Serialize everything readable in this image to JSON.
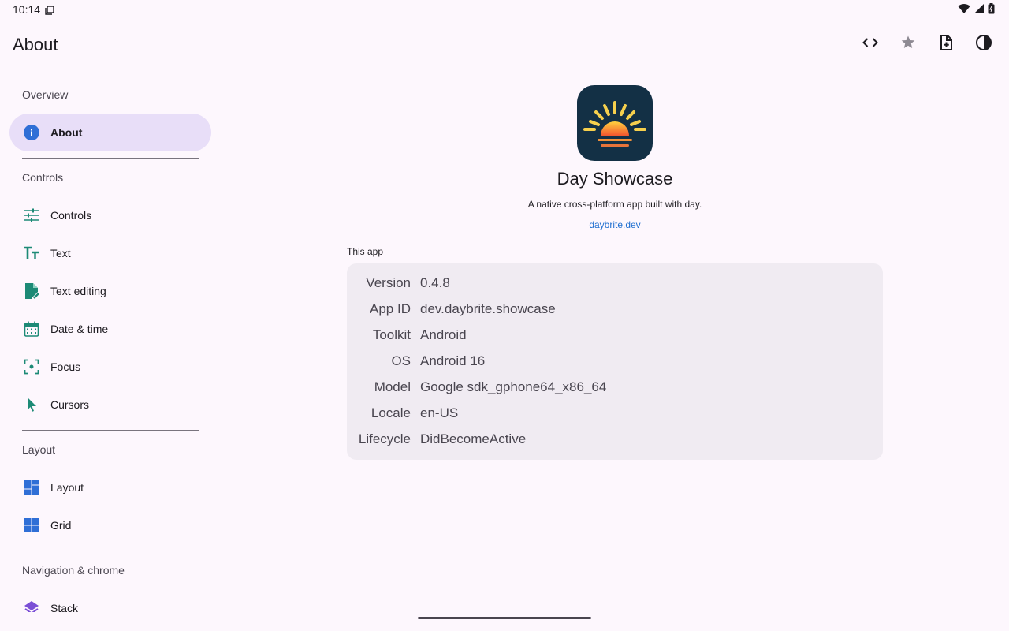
{
  "status_bar": {
    "time": "10:14"
  },
  "app_bar": {
    "title": "About",
    "actions": [
      {
        "name": "code-icon"
      },
      {
        "name": "star-icon"
      },
      {
        "name": "note-add-icon"
      },
      {
        "name": "contrast-icon"
      }
    ]
  },
  "sidebar": {
    "sections": [
      {
        "header": "Overview",
        "items": [
          {
            "label": "About",
            "icon": "info-icon",
            "selected": true
          }
        ]
      },
      {
        "header": "Controls",
        "items": [
          {
            "label": "Controls",
            "icon": "tune-icon"
          },
          {
            "label": "Text",
            "icon": "text-fields-icon"
          },
          {
            "label": "Text editing",
            "icon": "edit-document-icon"
          },
          {
            "label": "Date & time",
            "icon": "calendar-icon"
          },
          {
            "label": "Focus",
            "icon": "focus-icon"
          },
          {
            "label": "Cursors",
            "icon": "cursor-icon"
          }
        ]
      },
      {
        "header": "Layout",
        "items": [
          {
            "label": "Layout",
            "icon": "layout-icon"
          },
          {
            "label": "Grid",
            "icon": "grid-icon"
          }
        ]
      },
      {
        "header": "Navigation & chrome",
        "items": [
          {
            "label": "Stack",
            "icon": "stack-icon"
          }
        ]
      }
    ]
  },
  "main": {
    "app_name": "Day Showcase",
    "tagline": "A native cross-platform app built with day.",
    "link": "daybrite.dev",
    "card_label": "This app",
    "rows": [
      {
        "key": "Version",
        "value": "0.4.8"
      },
      {
        "key": "App ID",
        "value": "dev.daybrite.showcase"
      },
      {
        "key": "Toolkit",
        "value": "Android"
      },
      {
        "key": "OS",
        "value": "Android 16"
      },
      {
        "key": "Model",
        "value": "Google sdk_gphone64_x86_64"
      },
      {
        "key": "Locale",
        "value": "en-US"
      },
      {
        "key": "Lifecycle",
        "value": "DidBecomeActive"
      }
    ]
  },
  "colors": {
    "background": "#fdf7fd",
    "selected": "#e8def8",
    "accent_teal": "#1d8a76",
    "accent_blue": "#2f6fd6",
    "link": "#1f6fd0",
    "card": "#f0ebf2"
  }
}
